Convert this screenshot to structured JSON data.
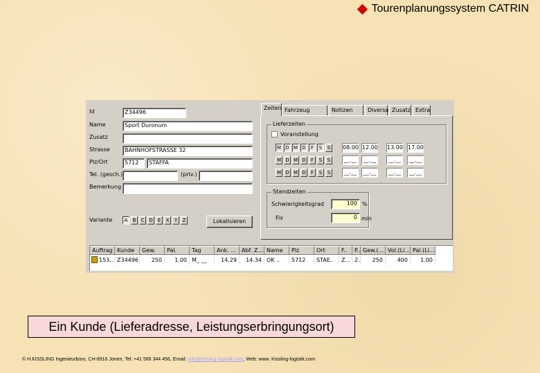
{
  "slide": {
    "title": "Tourenplanungssystem CATRIN",
    "caption": "Ein Kunde (Lieferadresse, Leistungserbringungsort)",
    "footer": {
      "pre": "© H.KISSLING Ingenieurbüro, CH-8916 Jonen, Tel: +41 566 344 456, Email: ",
      "email": "info@kissling-logistik.com",
      "post": ", Web: www. Kissling-logistik.com"
    }
  },
  "form": {
    "id_label": "Id",
    "id_value": "Z34496",
    "name_label": "Name",
    "name_value": "Sport Duronum",
    "zusatz_label": "Zusatz",
    "zusatz_value": "",
    "strasse_label": "Strasse",
    "strasse_value": "BAHNHOFSTRASSE 32",
    "plz_label": "Plz/Ort",
    "plz_value": "5712",
    "ort_value": "STAFFA",
    "tel_label": "Tel. (gesch.)",
    "tel_value": "",
    "tel_priv_label": "(priv.)",
    "tel_priv_value": "",
    "bemerkung_label": "Bemerkung",
    "bemerkung_value": "",
    "variante_label": "Variante",
    "variante_letters": [
      "A",
      "B",
      "C",
      "D",
      "E",
      "X",
      "Y",
      "Z"
    ],
    "lokalisieren_label": "Lokalisieren"
  },
  "tabs": [
    "Zeiten",
    "Fahrzeug",
    "Notizen",
    "Diverse",
    "Zusatz",
    "Extra"
  ],
  "lieferzeiten": {
    "title": "Lieferzeiten",
    "voranstellung_label": "Voranstellung",
    "days": [
      "M",
      "D",
      "M",
      "D",
      "F",
      "S",
      "S"
    ],
    "rows": [
      {
        "times": [
          "08.00",
          "12.00",
          "13.00",
          "17.00"
        ]
      },
      {
        "times": [
          "__.__",
          "__.__",
          "__.__",
          "__.__"
        ]
      },
      {
        "times": [
          "__.__",
          "__.__",
          "__.__",
          "__.__"
        ]
      }
    ]
  },
  "standzeiten": {
    "title": "Standzeiten",
    "schwierigkeit_label": "Schwierigkeitsgrad",
    "schwierigkeit_value": "100",
    "schwierigkeit_unit": "%",
    "fix_label": "Fix",
    "fix_value": "0",
    "fix_unit": "min"
  },
  "table": {
    "columns": [
      "Auftrag",
      "Kunde",
      "Gew.",
      "Pal.",
      "Tag",
      "Ank. ...",
      "Abf. Z...",
      "Name",
      "Plz",
      "Ort",
      "F..",
      "P..",
      "Gew.(...",
      "Vol.(Li...",
      "Pal.(Li..."
    ],
    "rows": [
      [
        "153..",
        "Z34496",
        "250",
        "1.00",
        "M_ __",
        "14.29",
        "14.34",
        "OK ..",
        "5712",
        "STAE..",
        "Z...",
        "2..",
        "250",
        "400",
        "1.00"
      ]
    ]
  }
}
